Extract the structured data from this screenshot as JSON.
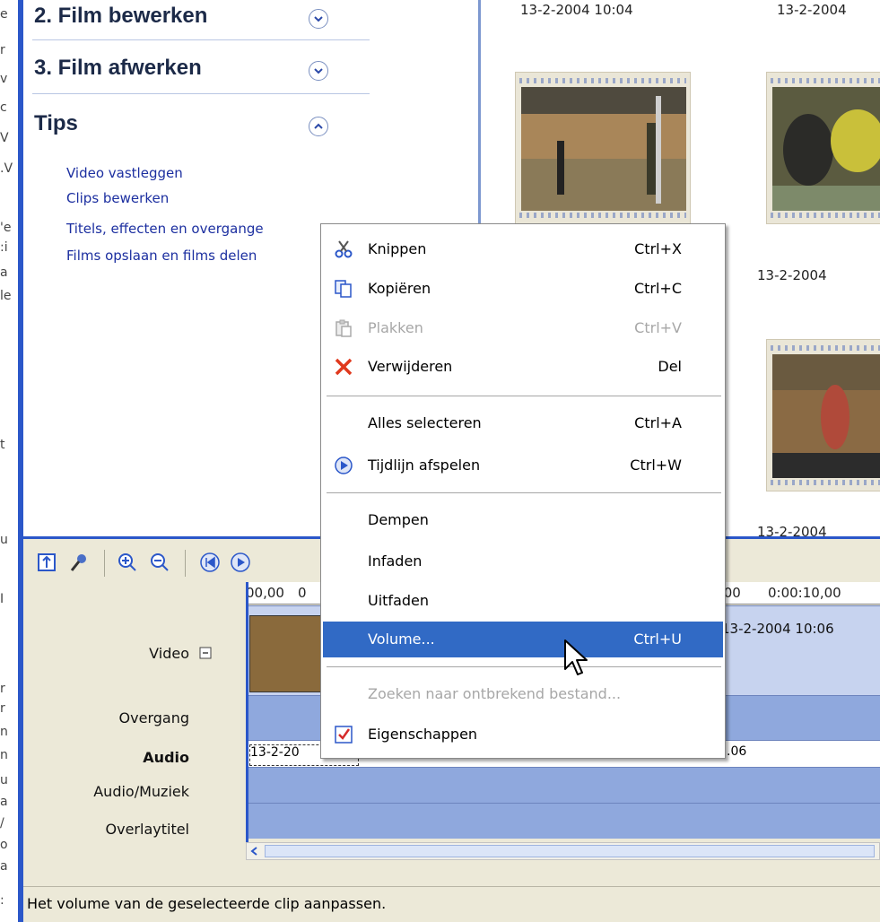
{
  "task_pane": {
    "sections": [
      {
        "label": "2. Film bewerken",
        "state": "collapsed"
      },
      {
        "label": "3. Film afwerken",
        "state": "collapsed"
      },
      {
        "label": "Tips",
        "state": "expanded"
      }
    ],
    "tips_links": [
      "Video vastleggen",
      "Clips bewerken",
      "Titels, effecten en overgange",
      "Films opslaan en films delen"
    ]
  },
  "collection": {
    "top_dates": [
      "13-2-2004 10:04",
      "13-2-2004"
    ],
    "mid_date": "13-2-2004",
    "bottom_date": "13-2-2004"
  },
  "timeline": {
    "ruler": [
      "00,00",
      "0",
      ",00",
      "0:00:10,00"
    ],
    "track_labels": {
      "video": "Video",
      "transition": "Overgang",
      "audio": "Audio",
      "audio_music": "Audio/Muziek",
      "overlay_title": "Overlaytitel"
    },
    "video_clip_date": "13-2-2004 10:06",
    "audio_clip_left": "13-2-20",
    "audio_clip_right": ".06"
  },
  "context_menu": {
    "items": [
      {
        "label": "Knippen",
        "shortcut": "Ctrl+X",
        "icon": "scissors-icon",
        "enabled": true
      },
      {
        "label": "Kopiëren",
        "shortcut": "Ctrl+C",
        "icon": "copy-icon",
        "enabled": true
      },
      {
        "label": "Plakken",
        "shortcut": "Ctrl+V",
        "icon": "paste-icon",
        "enabled": false
      },
      {
        "label": "Verwijderen",
        "shortcut": "Del",
        "icon": "delete-x-icon",
        "enabled": true
      },
      {
        "label": "Alles selecteren",
        "shortcut": "Ctrl+A",
        "enabled": true
      },
      {
        "label": "Tijdlijn afspelen",
        "shortcut": "Ctrl+W",
        "icon": "play-icon",
        "enabled": true
      },
      {
        "label": "Dempen",
        "shortcut": "",
        "enabled": true
      },
      {
        "label": "Infaden",
        "shortcut": "",
        "enabled": true
      },
      {
        "label": "Uitfaden",
        "shortcut": "",
        "enabled": true
      },
      {
        "label": "Volume...",
        "shortcut": "Ctrl+U",
        "enabled": true,
        "highlighted": true
      },
      {
        "label": "Zoeken naar ontbrekend bestand...",
        "shortcut": "",
        "enabled": false
      },
      {
        "label": "Eigenschappen",
        "shortcut": "",
        "icon": "properties-icon",
        "enabled": true
      }
    ]
  },
  "statusbar": {
    "text": "Het volume van de geselecteerde clip aanpassen."
  },
  "colors": {
    "highlight": "#316ac5",
    "window_border": "#2b57c9",
    "track_fill": "#8fa8dd",
    "link": "#1c2fa0"
  }
}
